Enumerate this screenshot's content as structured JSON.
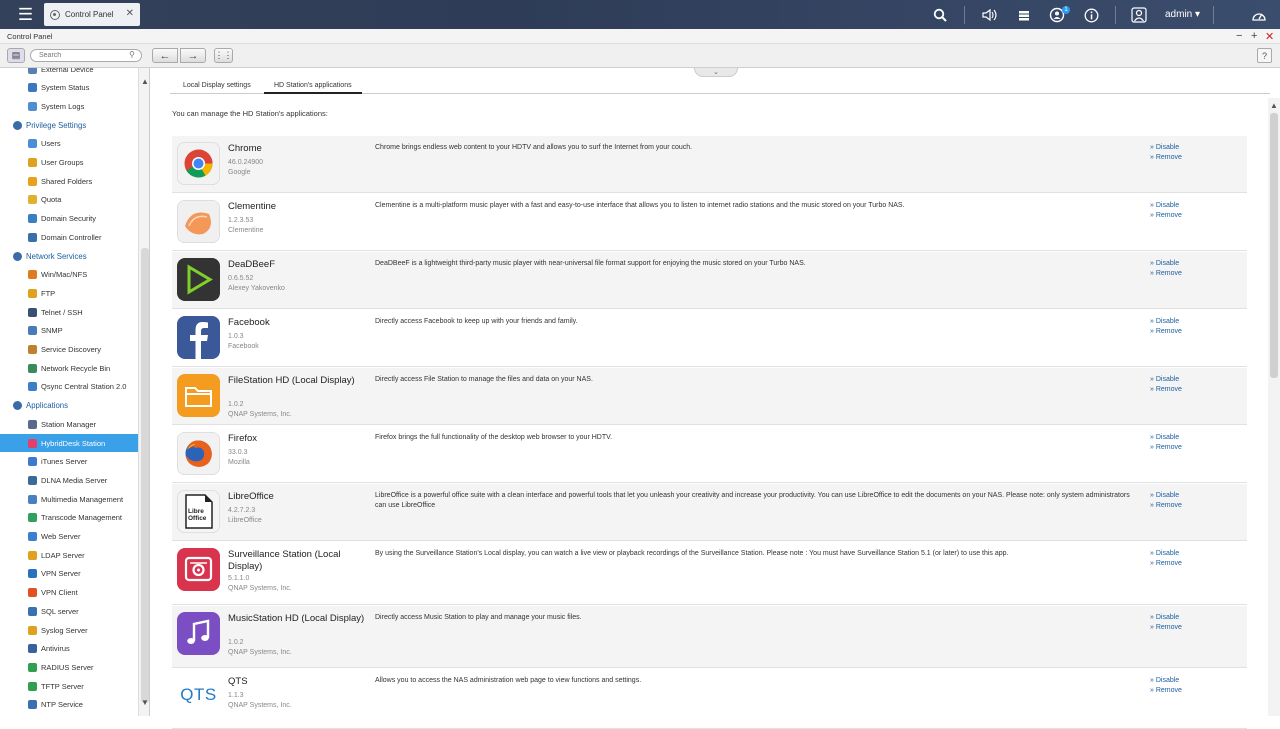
{
  "topbar": {
    "tab_label": "Control Panel",
    "user": "admin",
    "notification_count": "1"
  },
  "window": {
    "title": "Control Panel"
  },
  "toolbar": {
    "search_placeholder": "Search",
    "help": "?"
  },
  "sidebar": {
    "items": [
      {
        "label": "External Device",
        "type": "sub",
        "icon": "usb-icon",
        "color": "#5a7fb5"
      },
      {
        "label": "System Status",
        "type": "sub",
        "icon": "monitor-icon",
        "color": "#3a78c2"
      },
      {
        "label": "System Logs",
        "type": "sub",
        "icon": "log-icon",
        "color": "#4f8fd0"
      },
      {
        "label": "Privilege Settings",
        "type": "grp",
        "icon": "user-group-icon",
        "color": "#3a6aa8"
      },
      {
        "label": "Users",
        "type": "sub",
        "icon": "user-icon",
        "color": "#4d8cd6"
      },
      {
        "label": "User Groups",
        "type": "sub",
        "icon": "users-icon",
        "color": "#e0a020"
      },
      {
        "label": "Shared Folders",
        "type": "sub",
        "icon": "folder-icon",
        "color": "#e8a020"
      },
      {
        "label": "Quota",
        "type": "sub",
        "icon": "quota-icon",
        "color": "#e0b030"
      },
      {
        "label": "Domain Security",
        "type": "sub",
        "icon": "shield-icon",
        "color": "#3a80c0"
      },
      {
        "label": "Domain Controller",
        "type": "sub",
        "icon": "server-icon",
        "color": "#3a70a8"
      },
      {
        "label": "Network Services",
        "type": "grp",
        "icon": "globe-icon",
        "color": "#3a6aa8"
      },
      {
        "label": "Win/Mac/NFS",
        "type": "sub",
        "icon": "os-icon",
        "color": "#e07a20"
      },
      {
        "label": "FTP",
        "type": "sub",
        "icon": "ftp-icon",
        "color": "#e0a020"
      },
      {
        "label": "Telnet / SSH",
        "type": "sub",
        "icon": "terminal-icon",
        "color": "#3a5070"
      },
      {
        "label": "SNMP",
        "type": "sub",
        "icon": "chart-icon",
        "color": "#4a7ab8"
      },
      {
        "label": "Service Discovery",
        "type": "sub",
        "icon": "discovery-icon",
        "color": "#c08030"
      },
      {
        "label": "Network Recycle Bin",
        "type": "sub",
        "icon": "recycle-icon",
        "color": "#3a8a5a"
      },
      {
        "label": "Qsync Central Station 2.0",
        "type": "sub",
        "icon": "qsync-icon",
        "color": "#3a80c8"
      },
      {
        "label": "Applications",
        "type": "grp",
        "icon": "apps-icon",
        "color": "#3a6aa8"
      },
      {
        "label": "Station Manager",
        "type": "sub",
        "icon": "station-icon",
        "color": "#5a6a8a"
      },
      {
        "label": "HybridDesk Station",
        "type": "sub",
        "icon": "hybriddesk-icon",
        "color": "#e0406a",
        "selected": true
      },
      {
        "label": "iTunes Server",
        "type": "sub",
        "icon": "itunes-icon",
        "color": "#3a7ad0"
      },
      {
        "label": "DLNA Media Server",
        "type": "sub",
        "icon": "dlna-icon",
        "color": "#3a6a9a"
      },
      {
        "label": "Multimedia Management",
        "type": "sub",
        "icon": "multimedia-icon",
        "color": "#4a80c0"
      },
      {
        "label": "Transcode Management",
        "type": "sub",
        "icon": "transcode-icon",
        "color": "#30a060"
      },
      {
        "label": "Web Server",
        "type": "sub",
        "icon": "web-icon",
        "color": "#3a80d0"
      },
      {
        "label": "LDAP Server",
        "type": "sub",
        "icon": "ldap-icon",
        "color": "#e0a020"
      },
      {
        "label": "VPN Server",
        "type": "sub",
        "icon": "vpn-icon",
        "color": "#2a70c0"
      },
      {
        "label": "VPN Client",
        "type": "sub",
        "icon": "vpn-client-icon",
        "color": "#e05020"
      },
      {
        "label": "SQL server",
        "type": "sub",
        "icon": "database-icon",
        "color": "#3a70b0"
      },
      {
        "label": "Syslog Server",
        "type": "sub",
        "icon": "syslog-icon",
        "color": "#e0a020"
      },
      {
        "label": "Antivirus",
        "type": "sub",
        "icon": "antivirus-icon",
        "color": "#3a60a0"
      },
      {
        "label": "RADIUS Server",
        "type": "sub",
        "icon": "radius-icon",
        "color": "#30a050"
      },
      {
        "label": "TFTP Server",
        "type": "sub",
        "icon": "tftp-icon",
        "color": "#30a050"
      },
      {
        "label": "NTP Service",
        "type": "sub",
        "icon": "clock-icon",
        "color": "#3a70b0"
      }
    ]
  },
  "content": {
    "tabs": [
      "Local Display settings",
      "HD Station's applications"
    ],
    "active_tab": 1,
    "intro": "You can manage the HD Station's applications:",
    "disable_label": "» Disable",
    "remove_label": "» Remove",
    "apps": [
      {
        "name": "Chrome",
        "version": "46.0.24900",
        "vendor": "Google",
        "icon": "chrome-icon",
        "description": "Chrome brings endless web content to your HDTV and allows you to surf the Internet from your couch."
      },
      {
        "name": "Clementine",
        "version": "1.2.3.53",
        "vendor": "Clementine",
        "icon": "clementine-icon",
        "description": "Clementine is a multi-platform music player with a fast and easy-to-use interface that allows you to listen to internet radio stations and the music stored on your Turbo NAS."
      },
      {
        "name": "DeaDBeeF",
        "version": "0.6.5.52",
        "vendor": "Alexey Yakovenko",
        "icon": "deadbeef-icon",
        "description": "DeaDBeeF is a lightweight third-party music player with near-universal file format support for enjoying the music stored on your Turbo NAS."
      },
      {
        "name": "Facebook",
        "version": "1.0.3",
        "vendor": "Facebook",
        "icon": "facebook-icon",
        "description": "Directly access Facebook to keep up with your friends and family."
      },
      {
        "name": "FileStation HD (Local Display)",
        "version": "1.0.2",
        "vendor": "QNAP Systems, Inc.",
        "icon": "filestation-icon",
        "description": "Directly access File Station to manage the files and data on your NAS."
      },
      {
        "name": "Firefox",
        "version": "33.0.3",
        "vendor": "Mozilla",
        "icon": "firefox-icon",
        "description": "Firefox brings the full functionality of the desktop web browser to your HDTV."
      },
      {
        "name": "LibreOffice",
        "version": "4.2.7.2.3",
        "vendor": "LibreOffice",
        "icon": "libreoffice-icon",
        "logo_text": "Libre Office",
        "description": "LibreOffice is a powerful office suite with a clean interface and powerful tools that let you unleash your creativity and increase your productivity. You can use LibreOffice to edit the documents on your NAS. Please note: only system administrators can use LibreOffice"
      },
      {
        "name": "Surveillance Station (Local Display)",
        "version": "5.1.1.0",
        "vendor": "QNAP Systems, Inc.",
        "icon": "surveillance-icon",
        "description": "By using the Surveillance Station's Local display, you can watch a live view or playback recordings of the Surveillance Station. Please note : You must have Surveillance Station 5.1 (or later) to use this app."
      },
      {
        "name": "MusicStation HD (Local Display)",
        "version": "1.0.2",
        "vendor": "QNAP Systems, Inc.",
        "icon": "musicstation-icon",
        "description": "Directly access Music Station to play and manage your music files."
      },
      {
        "name": "QTS",
        "version": "1.1.3",
        "vendor": "QNAP Systems, Inc.",
        "icon": "qts-icon",
        "logo_text": "QTS",
        "description": "Allows you to access the NAS administration web page to view functions and settings."
      }
    ]
  }
}
